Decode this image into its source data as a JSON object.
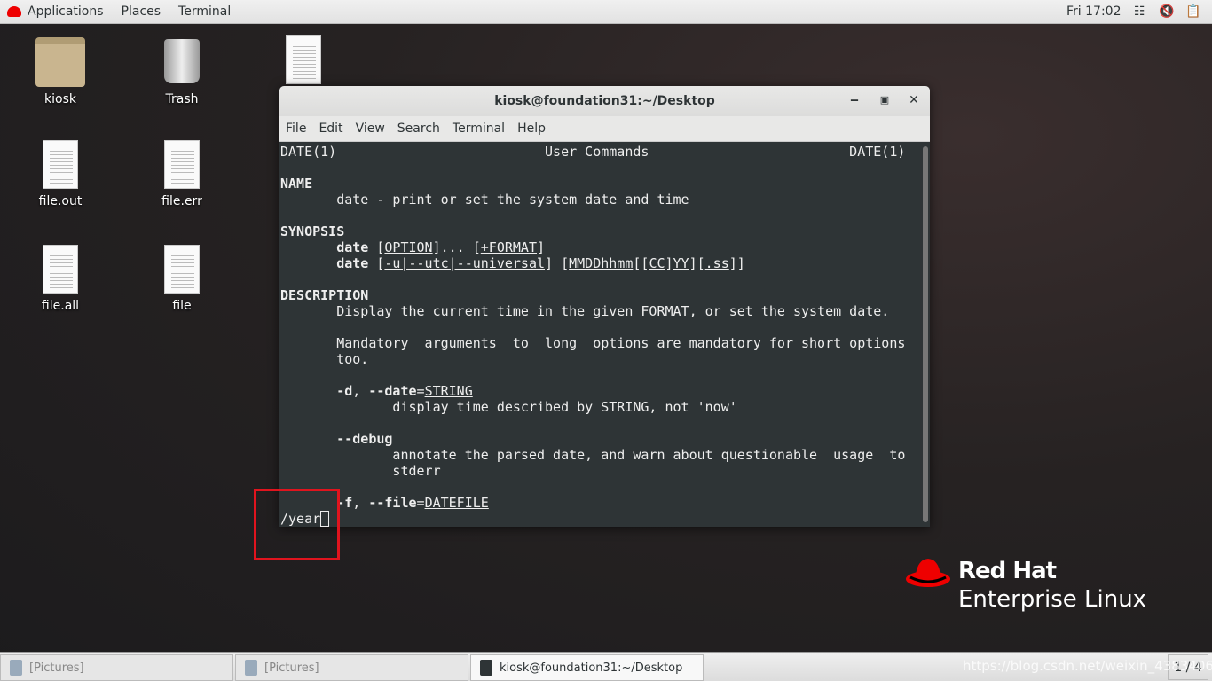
{
  "topbar": {
    "applications": "Applications",
    "places": "Places",
    "terminal": "Terminal",
    "clock": "Fri 17:02"
  },
  "desktop": {
    "icons": [
      {
        "label": "kiosk",
        "type": "folder"
      },
      {
        "label": "Trash",
        "type": "trash"
      },
      {
        "label": "file.out",
        "type": "document"
      },
      {
        "label": "file.err",
        "type": "document"
      },
      {
        "label": "file.all",
        "type": "document"
      },
      {
        "label": "file",
        "type": "document"
      },
      {
        "label": "",
        "type": "document"
      }
    ]
  },
  "window": {
    "title": "kiosk@foundation31:~/Desktop",
    "menu": [
      "File",
      "Edit",
      "View",
      "Search",
      "Terminal",
      "Help"
    ]
  },
  "terminal": {
    "lines": [
      [
        {
          "t": "DATE(1)                          User Commands                         DATE(1)"
        }
      ],
      [],
      [
        {
          "t": "NAME",
          "b": 1
        }
      ],
      [
        {
          "t": "       date - print or set the system date and time"
        }
      ],
      [],
      [
        {
          "t": "SYNOPSIS",
          "b": 1
        }
      ],
      [
        {
          "t": "       "
        },
        {
          "t": "date",
          "b": 1
        },
        {
          "t": " ["
        },
        {
          "t": "OPTION",
          "u": 1
        },
        {
          "t": "]... ["
        },
        {
          "t": "+FORMAT",
          "u": 1
        },
        {
          "t": "]"
        }
      ],
      [
        {
          "t": "       "
        },
        {
          "t": "date",
          "b": 1
        },
        {
          "t": " ["
        },
        {
          "t": "-u|--utc|--universal",
          "u": 1
        },
        {
          "t": "] ["
        },
        {
          "t": "MMDDhhmm",
          "u": 1
        },
        {
          "t": "[["
        },
        {
          "t": "CC",
          "u": 1
        },
        {
          "t": "]"
        },
        {
          "t": "YY",
          "u": 1
        },
        {
          "t": "]["
        },
        {
          "t": ".ss",
          "u": 1
        },
        {
          "t": "]]"
        }
      ],
      [],
      [
        {
          "t": "DESCRIPTION",
          "b": 1
        }
      ],
      [
        {
          "t": "       Display the current time in the given FORMAT, or set the system date."
        }
      ],
      [],
      [
        {
          "t": "       Mandatory  arguments  to  long  options are mandatory for short options"
        }
      ],
      [
        {
          "t": "       too."
        }
      ],
      [],
      [
        {
          "t": "       "
        },
        {
          "t": "-d",
          "b": 1
        },
        {
          "t": ", "
        },
        {
          "t": "--date",
          "b": 1
        },
        {
          "t": "="
        },
        {
          "t": "STRING",
          "u": 1
        }
      ],
      [
        {
          "t": "              display time described by STRING, not 'now'"
        }
      ],
      [],
      [
        {
          "t": "       "
        },
        {
          "t": "--debug",
          "b": 1
        }
      ],
      [
        {
          "t": "              annotate the parsed date, and warn about questionable  usage  to"
        }
      ],
      [
        {
          "t": "              stderr"
        }
      ],
      [],
      [
        {
          "t": "       "
        },
        {
          "t": "-f",
          "b": 1
        },
        {
          "t": ", "
        },
        {
          "t": "--file",
          "b": 1
        },
        {
          "t": "="
        },
        {
          "t": "DATEFILE",
          "u": 1
        }
      ]
    ],
    "search": "/year"
  },
  "branding": {
    "line1": "Red Hat",
    "line2": "Enterprise Linux",
    "color": "#ee0000"
  },
  "taskbar": {
    "tasks": [
      "[Pictures]",
      "[Pictures]",
      "kiosk@foundation31:~/Desktop"
    ],
    "pager": "1 / 4",
    "watermark": "https://blog.csdn.net/weixin_43834060"
  },
  "annotation": {
    "color": "#e0141e"
  }
}
